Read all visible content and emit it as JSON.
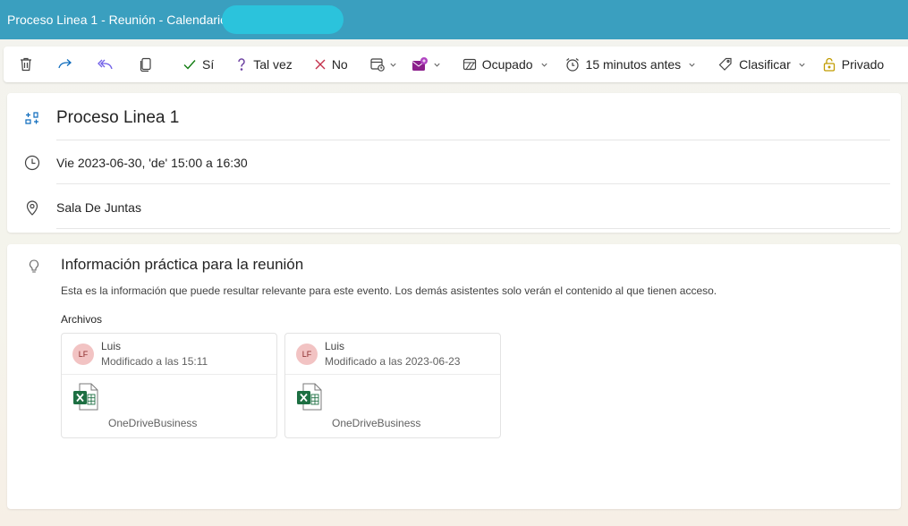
{
  "window": {
    "title": "Proceso Linea 1 - Reunión - Calendario"
  },
  "toolbar": {
    "delete_icon": "trash-icon",
    "forward_icon": "forward-arrow-icon",
    "reply_all_icon": "reply-all-icon",
    "copy_icon": "copy-icon",
    "yes_label": "Sí",
    "maybe_label": "Tal vez",
    "no_label": "No",
    "busy_label": "Ocupado",
    "reminder_label": "15 minutos antes",
    "categorize_label": "Clasificar",
    "private_label": "Privado"
  },
  "event": {
    "title": "Proceso Linea 1",
    "datetime": "Vie 2023-06-30, 'de' 15:00 a 16:30",
    "location": "Sala De Juntas"
  },
  "info": {
    "title": "Información práctica para la reunión",
    "description": "Esta es la información que puede resultar relevante para este evento. Los demás asistentes solo verán el contenido al que tienen acceso.",
    "files_label": "Archivos",
    "files": [
      {
        "initials": "LF",
        "user": "Luis",
        "modified": "Modificado a las 15:11",
        "source": "OneDriveBusiness"
      },
      {
        "initials": "LF",
        "user": "Luis",
        "modified": "Modificado a las 2023-06-23",
        "source": "OneDriveBusiness"
      }
    ]
  },
  "colors": {
    "titlebar": "#3a9fbf",
    "yes_green": "#107c10",
    "no_red": "#c4314b",
    "maybe_purple": "#6b3fa0",
    "forward_blue": "#0f6cbd",
    "reply_purple": "#7160e8",
    "excel_green": "#1d6f42"
  }
}
